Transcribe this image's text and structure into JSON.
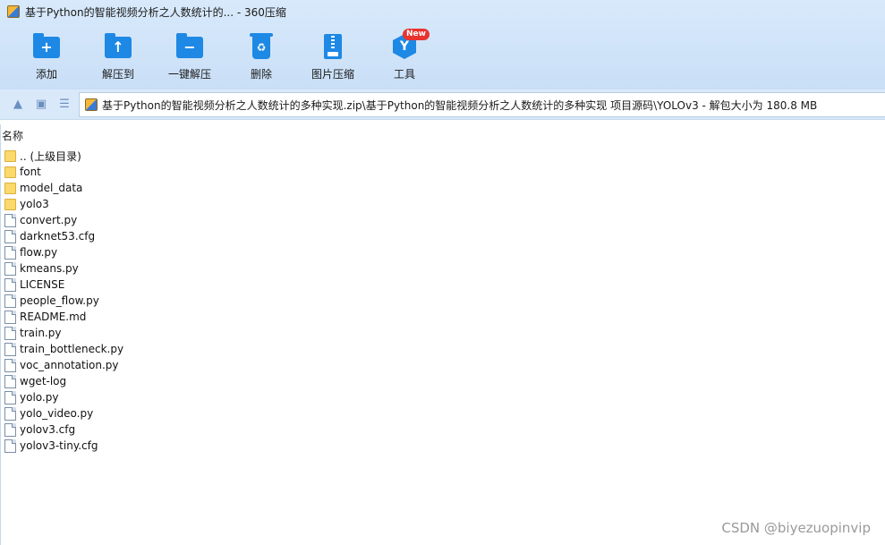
{
  "window": {
    "title": "基于Python的智能视频分析之人数统计的... - 360压缩"
  },
  "toolbar": {
    "add": "添加",
    "extract_to": "解压到",
    "one_click_extract": "一键解压",
    "delete": "删除",
    "image_compress": "图片压缩",
    "tools": "工具",
    "tools_badge": "New"
  },
  "address": {
    "path": "基于Python的智能视频分析之人数统计的多种实现.zip\\基于Python的智能视频分析之人数统计的多种实现 项目源码\\YOLOv3 - 解包大小为 180.8 MB"
  },
  "list": {
    "column_name": "名称",
    "items": [
      {
        "name": ".. (上级目录)",
        "type": "folder"
      },
      {
        "name": "font",
        "type": "folder"
      },
      {
        "name": "model_data",
        "type": "folder"
      },
      {
        "name": "yolo3",
        "type": "folder"
      },
      {
        "name": "convert.py",
        "type": "file"
      },
      {
        "name": "darknet53.cfg",
        "type": "file"
      },
      {
        "name": "flow.py",
        "type": "file"
      },
      {
        "name": "kmeans.py",
        "type": "file"
      },
      {
        "name": "LICENSE",
        "type": "file"
      },
      {
        "name": "people_flow.py",
        "type": "file"
      },
      {
        "name": "README.md",
        "type": "file"
      },
      {
        "name": "train.py",
        "type": "file"
      },
      {
        "name": "train_bottleneck.py",
        "type": "file"
      },
      {
        "name": "voc_annotation.py",
        "type": "file"
      },
      {
        "name": "wget-log",
        "type": "file"
      },
      {
        "name": "yolo.py",
        "type": "file"
      },
      {
        "name": "yolo_video.py",
        "type": "file"
      },
      {
        "name": "yolov3.cfg",
        "type": "file"
      },
      {
        "name": "yolov3-tiny.cfg",
        "type": "file"
      }
    ]
  },
  "watermark": "CSDN @biyezuopinvip"
}
